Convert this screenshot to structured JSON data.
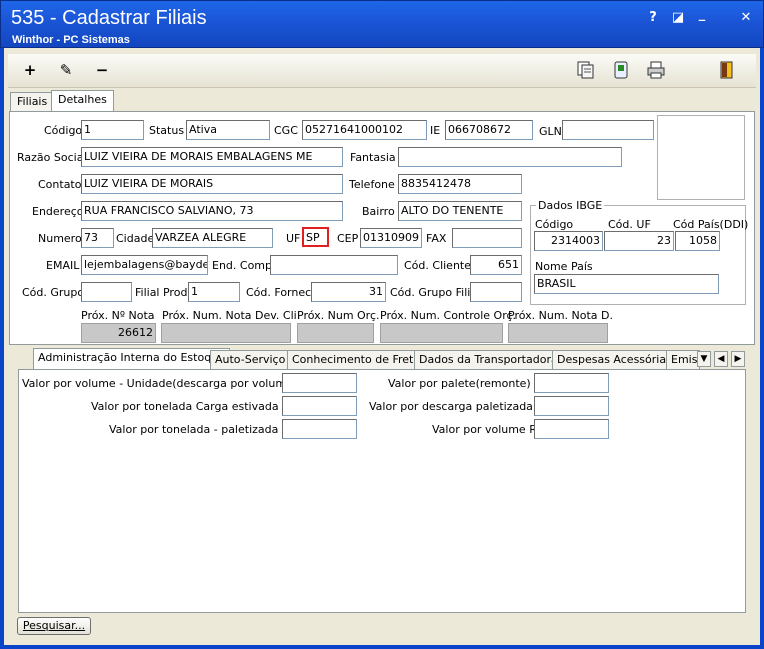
{
  "window": {
    "title": "535 - Cadastrar Filiais",
    "subtitle": "Winthor - PC Sistemas",
    "help": "?",
    "minimize": "_",
    "close": "✕",
    "restore": "◪"
  },
  "toolbar": {
    "add": "+",
    "edit": "✎",
    "remove": "−"
  },
  "tabs": {
    "filiais": "Filiais",
    "detalhes": "Detalhes"
  },
  "form": {
    "codigo_label": "Código",
    "codigo": "1",
    "status_label": "Status",
    "status": "Ativa",
    "cgc_label": "CGC",
    "cgc": "05271641000102",
    "ie_label": "IE",
    "ie": "066708672",
    "gln_label": "GLN",
    "gln": "",
    "razao_label": "Razão Social",
    "razao": "LUIZ VIEIRA DE MORAIS EMBALAGENS ME",
    "fantasia_label": "Fantasia",
    "fantasia": "",
    "contato_label": "Contato",
    "contato": "LUIZ VIEIRA DE MORAIS",
    "telefone_label": "Telefone",
    "telefone": "8835412478",
    "endereco_label": "Endereço",
    "endereco": "RUA FRANCISCO SALVIANO, 73",
    "bairro_label": "Bairro",
    "bairro": "ALTO DO TENENTE",
    "numero_label": "Numero",
    "numero": "73",
    "cidade_label": "Cidade",
    "cidade": "VARZEA ALEGRE",
    "uf_label": "UF",
    "uf": "SP",
    "cep_label": "CEP",
    "cep": "01310909",
    "fax_label": "FAX",
    "fax": "",
    "email_label": "EMAIL",
    "email": "lejembalagens@baydenet",
    "endcomp_label": "End. Comp.",
    "endcomp": "",
    "codcliente_label": "Cód. Cliente",
    "codcliente": "651",
    "codgrupo_label": "Cód. Grupo",
    "codgrupo": "",
    "filialprod_label": "Filial Prod.",
    "filialprod": "1",
    "codfornec_label": "Cód. Fornec.",
    "codfornec": "31",
    "codgrupofilial_label": "Cód. Grupo Filial",
    "codgrupofilial": "",
    "proxnota_label": "Próx. Nº Nota",
    "proxnota": "26612",
    "proxnotadev_label": "Próx. Num. Nota Dev. Cli.",
    "proxorc_label": "Próx. Num Orç.",
    "proxctrl_label": "Próx. Num. Controle Orç.",
    "proxnotad_label": "Próx. Num. Nota D."
  },
  "ibge": {
    "title": "Dados IBGE",
    "codigo_label": "Código",
    "codigo": "2314003",
    "coduf_label": "Cód. UF",
    "coduf": "23",
    "codpais_label": "Cód País(DDI)",
    "codpais": "1058",
    "nomepais_label": "Nome País",
    "nomepais": "BRASIL"
  },
  "bottom_tabs": [
    "Administração Interna do Estoque",
    "Auto-Serviço",
    "Conhecimento de Frete",
    "Dados da Transportadora",
    "Despesas Acessórias",
    "Emiss"
  ],
  "estoque": {
    "vol_unid_label": "Valor por volume - Unidade(descarga por volume)R$:",
    "ton_estiv_label": "Valor por tonelada Carga estivada R$:",
    "ton_palet_label": "Valor por tonelada - paletizada R$:",
    "palete_label": "Valor por palete(remonte) R$:",
    "desc_palet_label": "Valor por descarga paletizada R$:",
    "volume_label": "Valor por volume R$:"
  },
  "pesquisar": "Pesquisar..."
}
